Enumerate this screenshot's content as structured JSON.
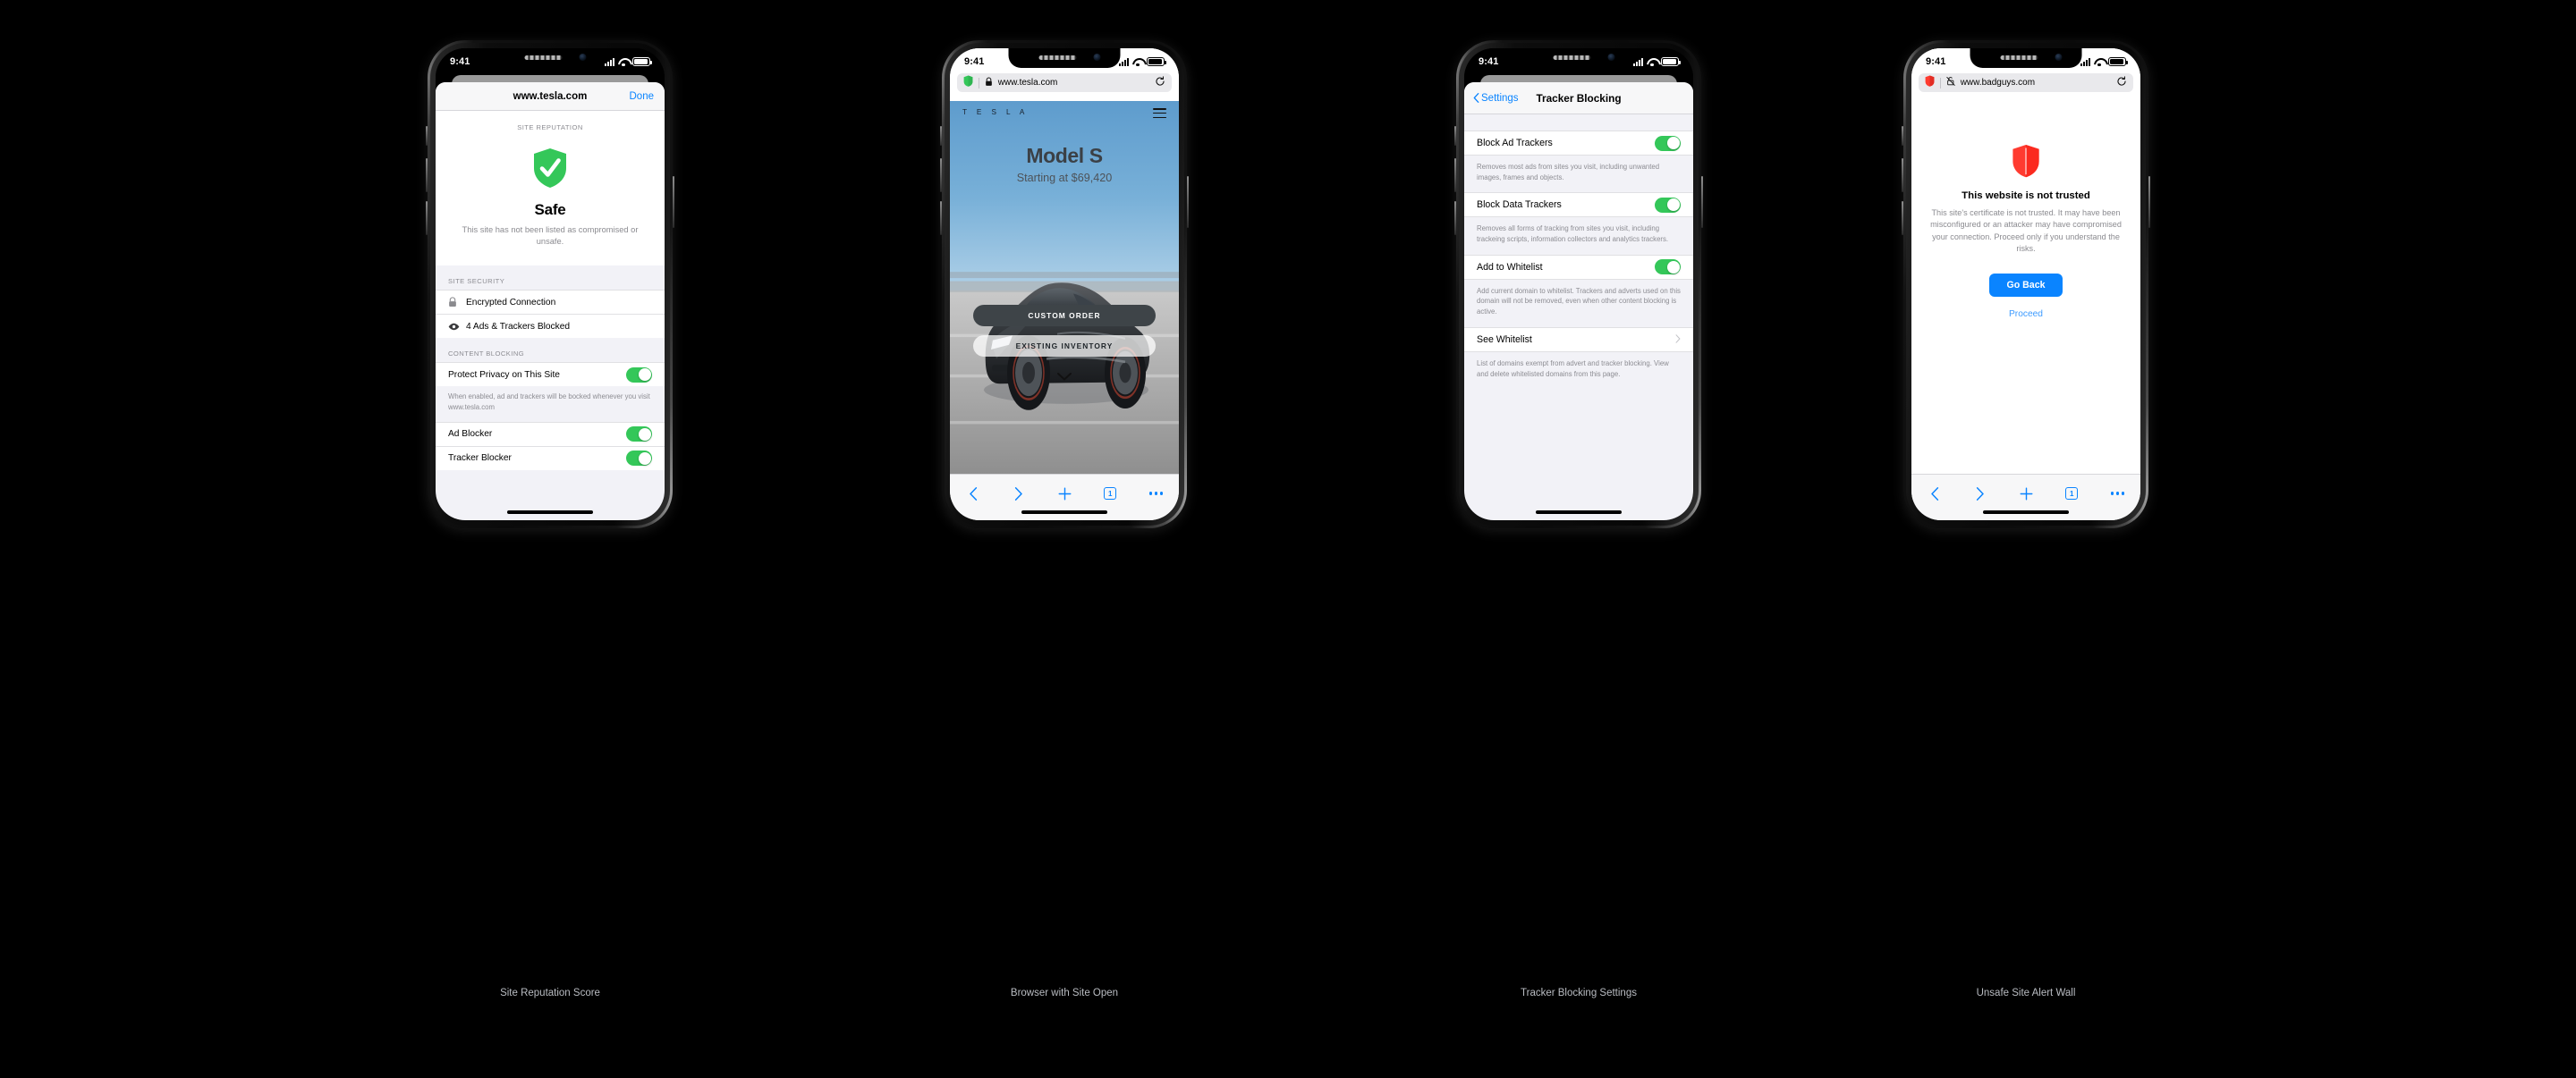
{
  "page": {
    "background": "#000000"
  },
  "phones": [
    {
      "caption": "Site Reputation Score",
      "status": {
        "time": "9:41"
      },
      "sheet": {
        "title": "www.tesla.com",
        "done_label": "Done",
        "reputation": {
          "section_label": "SITE REPUTATION",
          "icon": "shield-check-icon",
          "icon_color": "#34c759",
          "verdict": "Safe",
          "description": "This site has not been listed as compromised or unsafe."
        },
        "security": {
          "group_label": "SITE SECURITY",
          "rows": [
            {
              "icon": "lock-icon",
              "label": "Encrypted Connection"
            },
            {
              "icon": "eye-icon",
              "label": "4 Ads & Trackers Blocked"
            }
          ]
        },
        "content_blocking": {
          "group_label": "CONTENT BLOCKING",
          "rows": [
            {
              "label": "Protect Privacy on This Site",
              "toggle": "on"
            }
          ],
          "footnote": "When enabled, ad and trackers will be bocked whenever you visit www.tesla.com",
          "rows2": [
            {
              "label": "Ad Blocker",
              "toggle": "on"
            },
            {
              "label": "Tracker Blocker",
              "toggle": "on"
            }
          ]
        }
      }
    },
    {
      "caption": "Browser with Site Open",
      "status": {
        "time": "9:41"
      },
      "browser": {
        "shield_icon": "shield-icon",
        "shield_color": "#34c759",
        "lock_icon": "lock-icon",
        "url": "www.tesla.com",
        "reload_icon": "reload-icon"
      },
      "site": {
        "brand": "T E S L A",
        "menu_icon": "hamburger-icon",
        "hero_title": "Model S",
        "hero_subtitle": "Starting at $69,420",
        "primary_cta": "CUSTOM ORDER",
        "secondary_cta": "EXISTING INVENTORY",
        "scroll_icon": "chevron-down-icon"
      },
      "toolbar": {
        "back": "back-icon",
        "forward": "forward-icon",
        "new_tab": "plus-icon",
        "tab_count": "1",
        "more": "more-icon"
      }
    },
    {
      "caption": "Tracker Blocking Settings",
      "status": {
        "time": "9:41"
      },
      "nav": {
        "back_label": "Settings",
        "title": "Tracker Blocking"
      },
      "settings": [
        {
          "label": "Block Ad Trackers",
          "toggle": "on",
          "description": "Removes most ads from sites you visit, including unwanted images, frames and objects."
        },
        {
          "label": "Block Data Trackers",
          "toggle": "on",
          "description": "Removes all forms of tracking from sites you visit, including trackeing scripts, information collectors and analytics trackers."
        },
        {
          "label": "Add to Whitelist",
          "toggle": "on",
          "description": "Add current domain to whitelist. Trackers and adverts used on this domain will not be removed, even when other content blocking is active."
        },
        {
          "label": "See Whitelist",
          "toggle": "chevron",
          "description": "List of domains exempt from advert and tracker blocking. View and delete whitelisted domains from this page."
        }
      ]
    },
    {
      "caption": "Unsafe Site Alert Wall",
      "status": {
        "time": "9:41"
      },
      "browser": {
        "shield_icon": "shield-icon",
        "shield_color": "#ff3b30",
        "lock_icon": "lock-slash-icon",
        "url": "www.badguys.com",
        "reload_icon": "reload-icon"
      },
      "warning": {
        "icon": "shield-icon",
        "icon_color": "#ff3b30",
        "title": "This website is not trusted",
        "body": "This site's certificate is not trusted. It may have been misconfigured or an attacker may have compromised your connection. Proceed only if you understand the risks.",
        "primary_button": "Go Back",
        "secondary_link": "Proceed"
      },
      "toolbar": {
        "back": "back-icon",
        "forward": "forward-icon",
        "new_tab": "plus-icon",
        "tab_count": "1",
        "more": "more-icon"
      }
    }
  ]
}
